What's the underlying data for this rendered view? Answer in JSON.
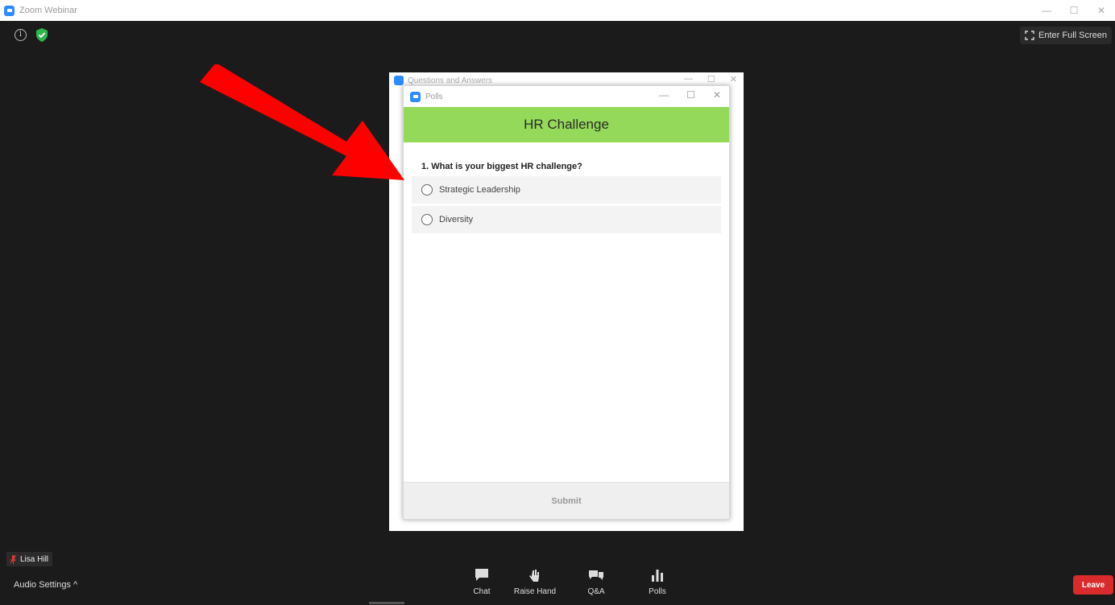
{
  "window": {
    "title": "Zoom Webinar",
    "minimize": "—",
    "maximize": "☐",
    "close": "✕"
  },
  "top": {
    "info_glyph": "i",
    "fullscreen_label": "Enter Full Screen"
  },
  "qa_window": {
    "title": "Questions and Answers",
    "minimize": "—",
    "maximize": "☐",
    "close": "✕"
  },
  "polls": {
    "window_title": "Polls",
    "minimize": "—",
    "maximize": "☐",
    "close": "✕",
    "header": "HR Challenge",
    "question": "1. What is your biggest HR challenge?",
    "options": [
      {
        "label": "Strategic Leadership"
      },
      {
        "label": "Diversity"
      }
    ],
    "submit_label": "Submit"
  },
  "participant": {
    "name": "Lisa Hill"
  },
  "bottom": {
    "audio_settings_label": "Audio Settings ^",
    "toolbar": [
      {
        "label": "Chat",
        "icon": "chat-icon"
      },
      {
        "label": "Raise Hand",
        "icon": "raise-hand-icon"
      },
      {
        "label": "Q&A",
        "icon": "qa-icon"
      },
      {
        "label": "Polls",
        "icon": "polls-icon"
      }
    ],
    "leave_label": "Leave"
  },
  "colors": {
    "poll_header": "#95d95a",
    "leave": "#d92b2b",
    "arrow": "#ff0000",
    "zoom_blue": "#2d8cff"
  }
}
